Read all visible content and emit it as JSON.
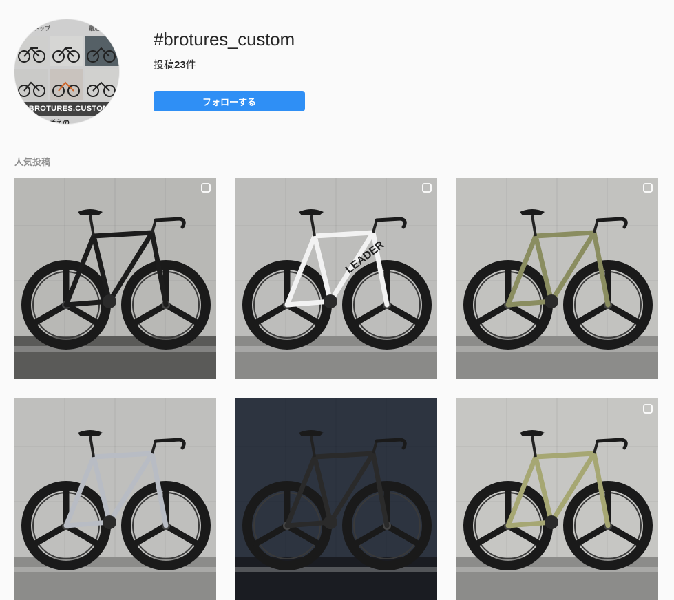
{
  "hashtag": {
    "title": "#brotures_custom",
    "posts_prefix": "投稿",
    "posts_count": "23",
    "posts_suffix": "件"
  },
  "avatar": {
    "tab_left": "トップ",
    "tab_right": "最近",
    "banner": "#BROTURES.CUSTOM",
    "subtext": "タムをお考えの"
  },
  "actions": {
    "follow_label": "フォローする"
  },
  "sections": {
    "top_posts_label": "人気投稿"
  },
  "posts": [
    {
      "id": "p1",
      "icon": "multiple-images-icon",
      "frame_color": "#1c1c1c",
      "wall": "#b8b8b5",
      "ground": "#5a5a58"
    },
    {
      "id": "p2",
      "icon": "multiple-images-icon",
      "frame_color": "#f2f2f2",
      "wall": "#bdbdbb",
      "ground": "#8a8a88",
      "frame_text": "LEADER"
    },
    {
      "id": "p3",
      "icon": "multiple-images-icon",
      "frame_color": "#8a8d60",
      "wall": "#c2c2bf",
      "ground": "#8c8c8a"
    },
    {
      "id": "p4",
      "icon": "",
      "frame_color": "#b8bcc4",
      "wall": "#bfbfbd",
      "ground": "#8c8c8a"
    },
    {
      "id": "p5",
      "icon": "",
      "frame_color": "#2a2a2a",
      "wall": "#2d3440",
      "ground": "#1a1c22"
    },
    {
      "id": "p6",
      "icon": "multiple-images-icon",
      "frame_color": "#a6a773",
      "wall": "#c6c6c3",
      "ground": "#8c8c8a"
    }
  ],
  "colors": {
    "accent": "#3897f0",
    "bg": "#fafafa",
    "muted": "#8e8e8e"
  }
}
